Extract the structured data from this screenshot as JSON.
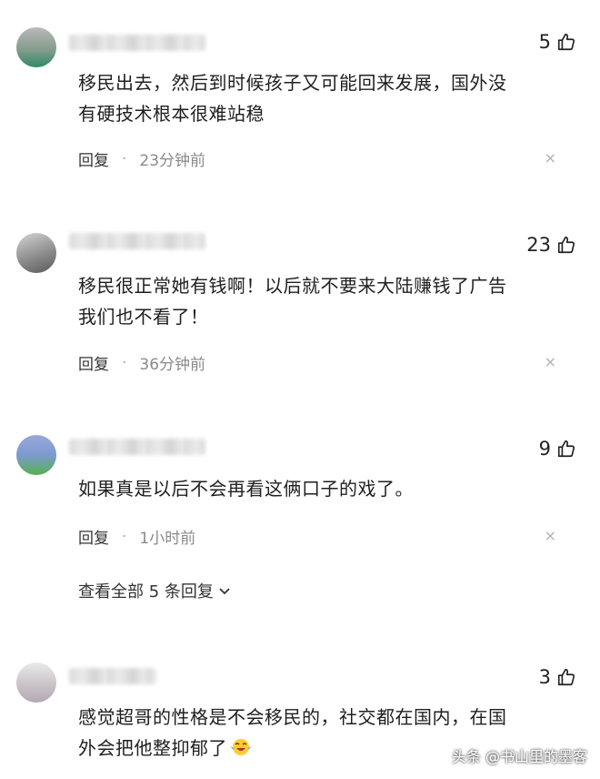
{
  "comments": [
    {
      "likes": "5",
      "text_line1": "移民出去，然后到时候孩子又可能回来发展，国外没",
      "text_line2": "有硬技术根本很难站稳",
      "reply_label": "回复",
      "separator": "·",
      "time": "23分钟前",
      "close": "×"
    },
    {
      "likes": "23",
      "text_line1": "移民很正常她有钱啊！以后就不要来大陆赚钱了广告",
      "text_line2": "我们也不看了！",
      "reply_label": "回复",
      "separator": "·",
      "time": "36分钟前",
      "close": "×"
    },
    {
      "likes": "9",
      "text_line1": "如果真是以后不会再看这俩口子的戏了。",
      "reply_label": "回复",
      "separator": "·",
      "time": "1小时前",
      "close": "×",
      "view_all": "查看全部 5 条回复"
    },
    {
      "likes": "3",
      "text_line1": "感觉超哥的性格是不会移民的，社交都在国内，在国",
      "text_line2": "外会把他整抑郁了"
    }
  ],
  "watermark": "头条 @书山里的墨客",
  "icons": {
    "like": "thumbs-up-icon",
    "close": "close-icon",
    "expand": "chevron-down-icon",
    "emoji": "crying-laughing-emoji"
  }
}
